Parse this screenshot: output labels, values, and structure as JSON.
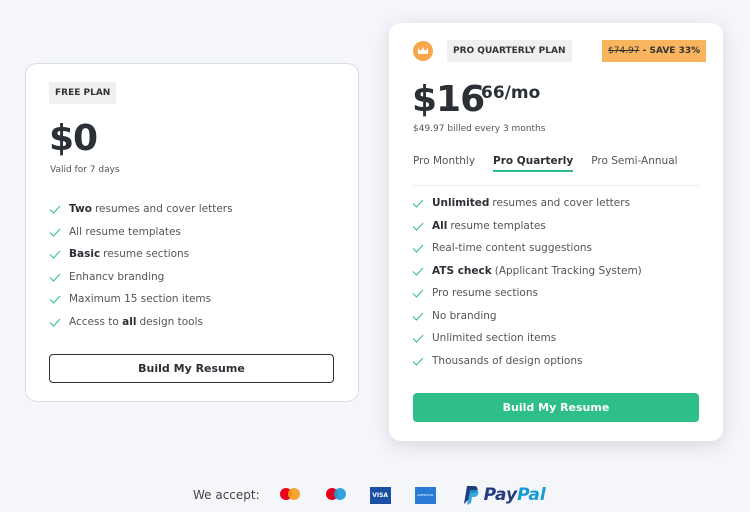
{
  "free": {
    "tag": "FREE PLAN",
    "price": "$0",
    "validity": "Valid for 7 days",
    "features": [
      {
        "pre": "",
        "bold": "Two",
        "post": "resumes and cover letters"
      },
      {
        "pre": "All resume templates",
        "bold": "",
        "post": ""
      },
      {
        "pre": "",
        "bold": "Basic",
        "post": "resume sections"
      },
      {
        "pre": "Enhancv branding",
        "bold": "",
        "post": ""
      },
      {
        "pre": "Maximum 15 section items",
        "bold": "",
        "post": ""
      },
      {
        "pre": "Access to ",
        "bold": "all",
        "post": "design tools"
      }
    ],
    "button": "Build My Resume"
  },
  "pro": {
    "tag": "PRO QUARTERLY PLAN",
    "old_price": "$74.97",
    "save": " - SAVE 33%",
    "price": "$16",
    "cents": "66/mo",
    "billing": "$49.97 billed every 3 months",
    "tabs": [
      {
        "label": "Pro Monthly",
        "active": false
      },
      {
        "label": "Pro Quarterly",
        "active": true
      },
      {
        "label": "Pro Semi-Annual",
        "active": false
      }
    ],
    "features": [
      {
        "pre": "",
        "bold": "Unlimited",
        "post": "resumes and cover letters"
      },
      {
        "pre": "",
        "bold": "All",
        "post": "resume templates"
      },
      {
        "pre": "Real-time content suggestions",
        "bold": "",
        "post": ""
      },
      {
        "pre": "",
        "bold": "ATS check",
        "post": "(Applicant Tracking System)"
      },
      {
        "pre": "Pro resume sections",
        "bold": "",
        "post": ""
      },
      {
        "pre": "No branding",
        "bold": "",
        "post": ""
      },
      {
        "pre": "Unlimited section items",
        "bold": "",
        "post": ""
      },
      {
        "pre": "Thousands of design options",
        "bold": "",
        "post": ""
      }
    ],
    "button": "Build My Resume"
  },
  "footer": {
    "label": "We accept:",
    "methods": [
      "mastercard",
      "maestro",
      "VISA",
      "AMERICAN EXPRESS",
      "PayPal"
    ]
  },
  "colors": {
    "accent": "#2dbf87",
    "crown": "#f7a74a",
    "save_badge": "#f8b55e"
  }
}
